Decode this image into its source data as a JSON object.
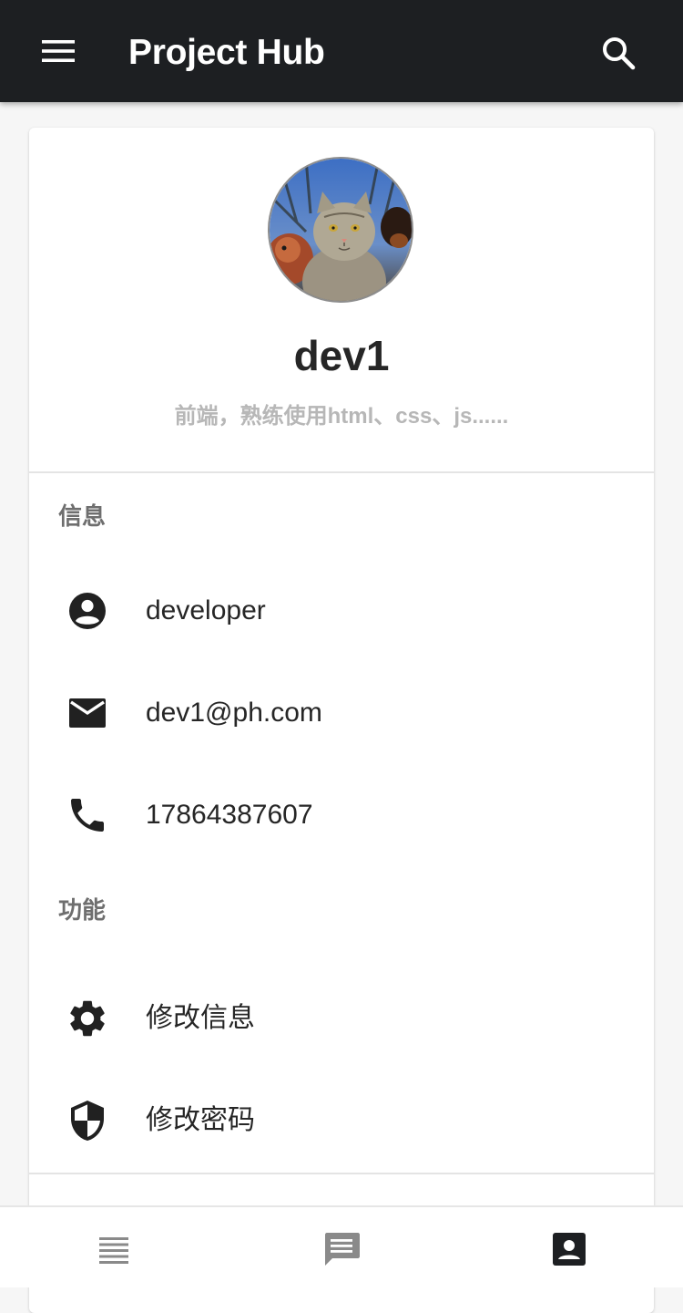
{
  "appbar": {
    "title": "Project Hub",
    "menu_icon": "menu-icon",
    "search_icon": "search-icon"
  },
  "profile": {
    "username": "dev1",
    "bio": "前端，熟练使用html、css、js......",
    "avatar": "avatar-image"
  },
  "info_section": {
    "label": "信息",
    "items": [
      {
        "icon": "account-circle-icon",
        "label": "developer"
      },
      {
        "icon": "email-icon",
        "label": "dev1@ph.com"
      },
      {
        "icon": "phone-icon",
        "label": "17864387607"
      }
    ]
  },
  "functions_section": {
    "label": "功能",
    "items": [
      {
        "icon": "gear-icon",
        "label": "修改信息"
      },
      {
        "icon": "shield-icon",
        "label": "修改密码"
      }
    ]
  },
  "bottom_nav": {
    "items": [
      {
        "icon": "list-icon",
        "active": false
      },
      {
        "icon": "message-icon",
        "active": false
      },
      {
        "icon": "contact-card-icon",
        "active": true
      }
    ]
  },
  "colors": {
    "appbar_bg": "#1d1f22",
    "page_bg": "#f6f6f6",
    "text_primary": "#262626",
    "text_secondary": "#6e6e6e",
    "text_muted": "#b7b7b7",
    "nav_inactive": "#8a8a8a",
    "nav_active": "#1d1f22"
  }
}
